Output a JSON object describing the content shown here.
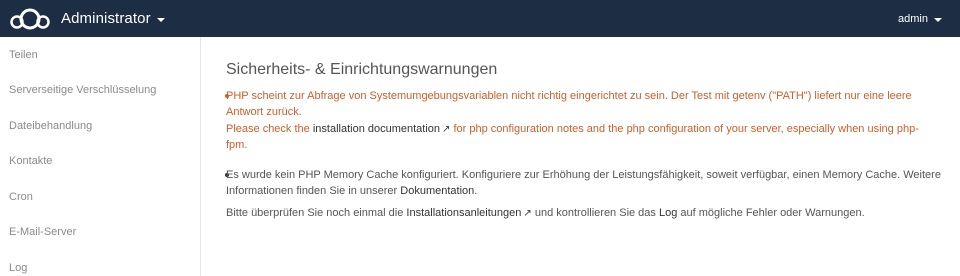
{
  "header": {
    "app_title": "Administrator",
    "user_name": "admin"
  },
  "sidebar": {
    "items": [
      {
        "label": "Teilen"
      },
      {
        "label": "Serverseitige Verschlüsselung"
      },
      {
        "label": "Dateibehandlung"
      },
      {
        "label": "Kontakte"
      },
      {
        "label": "Cron"
      },
      {
        "label": "E-Mail-Server"
      },
      {
        "label": "Log"
      }
    ]
  },
  "main": {
    "title": "Sicherheits- & Einrichtungswarnungen",
    "warning1": {
      "line1": "PHP scheint zur Abfrage von Systemumgebungsvariablen nicht richtig eingerichtet zu sein. Der Test mit getenv (\"PATH\") liefert nur eine leere",
      "line2": "Antwort zurück.",
      "line3_pre": "Please check the",
      "line3_link": "installation documentation",
      "line3_post": "for php configuration notes and the php configuration of your server, especially when using php-",
      "line4": "fpm."
    },
    "warning2": {
      "line1": "Es wurde kein PHP Memory Cache konfiguriert. Konfiguriere zur Erhöhung der Leistungsfähigkeit, soweit verfügbar, einen Memory Cache. Weitere",
      "line2_pre": "Informationen finden Sie in unserer",
      "line2_link": "Dokumentation",
      "line2_post": "."
    },
    "footer": {
      "pre": "Bitte überprüfen Sie noch einmal die",
      "link1": "Installationsanleitungen",
      "mid": "und kontrollieren Sie das",
      "link2": "Log",
      "post": "auf mögliche Fehler oder Warnungen."
    },
    "external_arrow": "↗"
  }
}
